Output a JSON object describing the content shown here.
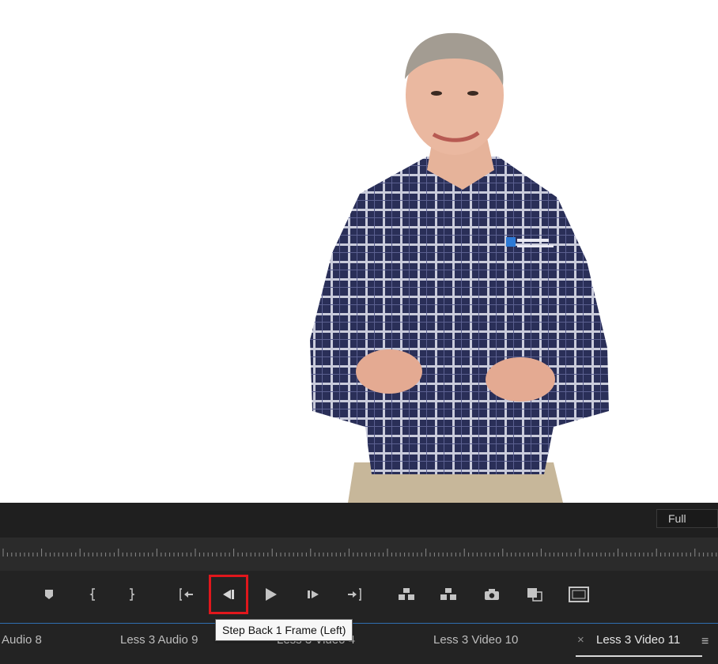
{
  "program_monitor": {
    "zoom_value": "Full"
  },
  "transport_controls": [
    {
      "name": "add-marker-button",
      "icon": "marker-icon"
    },
    {
      "name": "mark-in-button",
      "icon": "mark-in-icon"
    },
    {
      "name": "mark-out-button",
      "icon": "mark-out-icon"
    },
    {
      "name": "go-to-in-button",
      "icon": "go-to-in-icon"
    },
    {
      "name": "step-back-button",
      "icon": "step-back-icon"
    },
    {
      "name": "play-button",
      "icon": "play-icon"
    },
    {
      "name": "step-forward-button",
      "icon": "step-forward-icon"
    },
    {
      "name": "go-to-out-button",
      "icon": "go-to-out-icon"
    },
    {
      "name": "lift-button",
      "icon": "lift-icon"
    },
    {
      "name": "extract-button",
      "icon": "extract-icon"
    },
    {
      "name": "export-frame-button",
      "icon": "camera-icon"
    },
    {
      "name": "comparison-view-button",
      "icon": "comparison-icon"
    },
    {
      "name": "safe-margins-button",
      "icon": "safe-margins-icon"
    }
  ],
  "tooltip": {
    "text": "Step Back 1 Frame (Left)"
  },
  "tabs": [
    {
      "label": "Audio 8"
    },
    {
      "label": "Less 3 Audio 9"
    },
    {
      "label": "Less 3 Video 4"
    },
    {
      "label": "Less 3 Video 10"
    },
    {
      "label": "Less 3 Video 11",
      "active": true
    }
  ],
  "tab_close_glyph": "×",
  "panel_menu_glyph": "≡",
  "colors": {
    "highlight": "#e0171c",
    "divider": "#2f6fb1",
    "panel": "#232323"
  }
}
